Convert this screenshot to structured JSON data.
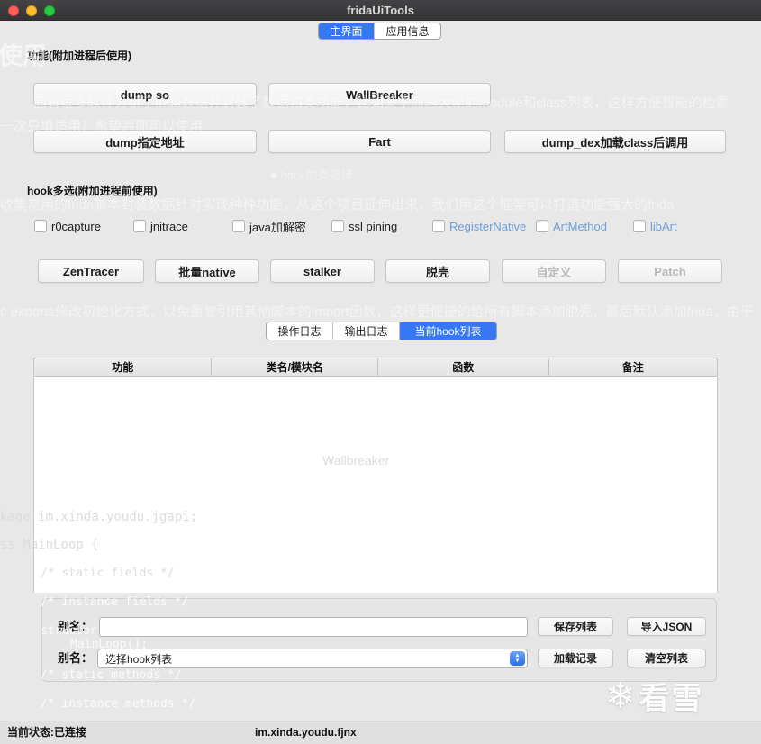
{
  "window": {
    "title": "fridaUiTools",
    "status_left": "当前状态:已连接",
    "status_center": "im.xinda.youdu.fjnx"
  },
  "colors": {
    "accent_blue": "#3577f5",
    "highlight_checkbox_label": "#6d9ed6",
    "titlebar": "#3a3a3c",
    "close_button": "#ff5f57",
    "minimize_button": "#febc2e",
    "zoom_button": "#28c840"
  },
  "top_tabs": [
    {
      "label": "主界面",
      "selected": true
    },
    {
      "label": "应用信息",
      "selected": false
    }
  ],
  "sections": {
    "func_label": "功能(附加进程后使用)",
    "hook_label": "hook多选(附加进程前使用)"
  },
  "func_buttons": {
    "row1": [
      "dump so",
      "WallBreaker"
    ],
    "row2": [
      "dump指定地址",
      "Fart",
      "dump_dex加载class后调用"
    ]
  },
  "checkboxes": [
    {
      "label": "r0capture",
      "checked": false
    },
    {
      "label": "jnitrace",
      "checked": false
    },
    {
      "label": "java加解密",
      "checked": false
    },
    {
      "label": "ssl pining",
      "checked": false
    },
    {
      "label": "RegisterNative",
      "checked": false
    },
    {
      "label": "ArtMethod",
      "checked": false
    },
    {
      "label": "libArt",
      "checked": false
    }
  ],
  "hook_buttons": [
    {
      "label": "ZenTracer",
      "enabled": true
    },
    {
      "label": "批量native",
      "enabled": true
    },
    {
      "label": "stalker",
      "enabled": true
    },
    {
      "label": "脱壳",
      "enabled": true
    },
    {
      "label": "自定义",
      "enabled": false
    },
    {
      "label": "Patch",
      "enabled": false
    }
  ],
  "log_tabs": [
    {
      "label": "操作日志",
      "selected": false
    },
    {
      "label": "输出日志",
      "selected": false
    },
    {
      "label": "当前hook列表",
      "selected": true
    }
  ],
  "table": {
    "headers": [
      "功能",
      "类名/模块名",
      "函数",
      "备注"
    ],
    "rows": []
  },
  "form": {
    "alias1_label": "别名：",
    "alias1_value": "",
    "save_button": "保存列表",
    "import_button": "导入JSON",
    "alias2_label": "别名：",
    "select_value": "选择hook列表",
    "load_button": "加载记录",
    "clear_button": "清空列表"
  },
  "watermark": {
    "icon": "❄",
    "label": "看雪"
  },
  "ghost": [
    "使用",
    "面有很多软件分析了frida数据并封装了数据归类功能，比如某学而思大佬的module和class列表，这样方便智能的检索",
    "一次只填适用？希望后面可以使用",
    "■ hook的类选择",
    "收集常用的frida脚本封装数据针对实现种种功能，从这个项目延伸出来，我们用这个框架可以打造功能强大的frida",
    "c exports修改初始化方式，以免重复引用其他脚本的import函数，这样更便捷的给所有脚本添加脱壳，最后默认添加frida，由于",
    "Wallbreaker",
    "kage im.xinda.youdu.jgapi;",
    "ss MainLoop {",
    "/* static fields */",
    "/* instance fields */",
    "structor methods */",
    "MainLoop();",
    "/* static methods */",
    "/* instance methods */"
  ]
}
